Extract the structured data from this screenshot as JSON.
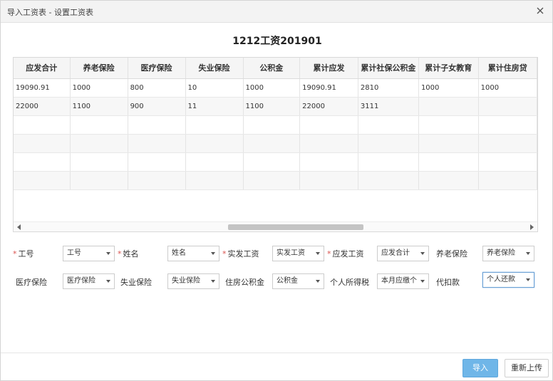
{
  "dialog": {
    "title": "导入工资表 - 设置工资表"
  },
  "sheet": {
    "title": "1212工资201901"
  },
  "grid": {
    "columns": [
      "应发合计",
      "养老保险",
      "医疗保险",
      "失业保险",
      "公积金",
      "累计应发",
      "累计社保公积金",
      "累计子女教育",
      "累计住房贷"
    ],
    "rows": [
      [
        "19090.91",
        "1000",
        "800",
        "10",
        "1000",
        "19090.91",
        "2810",
        "1000",
        "1000"
      ],
      [
        "22000",
        "1100",
        "900",
        "11",
        "1100",
        "22000",
        "3111",
        "",
        ""
      ],
      [
        "",
        "",
        "",
        "",
        "",
        "",
        "",
        "",
        ""
      ],
      [
        "",
        "",
        "",
        "",
        "",
        "",
        "",
        "",
        ""
      ],
      [
        "",
        "",
        "",
        "",
        "",
        "",
        "",
        "",
        ""
      ],
      [
        "",
        "",
        "",
        "",
        "",
        "",
        "",
        "",
        ""
      ]
    ]
  },
  "mapping": [
    {
      "label": "工号",
      "required": true,
      "value": "工号"
    },
    {
      "label": "姓名",
      "required": true,
      "value": "姓名"
    },
    {
      "label": "实发工资",
      "required": true,
      "value": "实发工资"
    },
    {
      "label": "应发工资",
      "required": true,
      "value": "应发合计"
    },
    {
      "label": "养老保险",
      "required": false,
      "value": "养老保险"
    },
    {
      "label": "医疗保险",
      "required": false,
      "value": "医疗保险"
    },
    {
      "label": "失业保险",
      "required": false,
      "value": "失业保险"
    },
    {
      "label": "住房公积金",
      "required": false,
      "value": "公积金"
    },
    {
      "label": "个人所得税",
      "required": false,
      "value": "本月应缴个"
    },
    {
      "label": "代扣款",
      "required": false,
      "value": "个人还款"
    }
  ],
  "buttons": {
    "import": "导入",
    "reupload": "重新上传"
  },
  "colors": {
    "primary": "#6fb6e8",
    "required": "#d9534f"
  }
}
